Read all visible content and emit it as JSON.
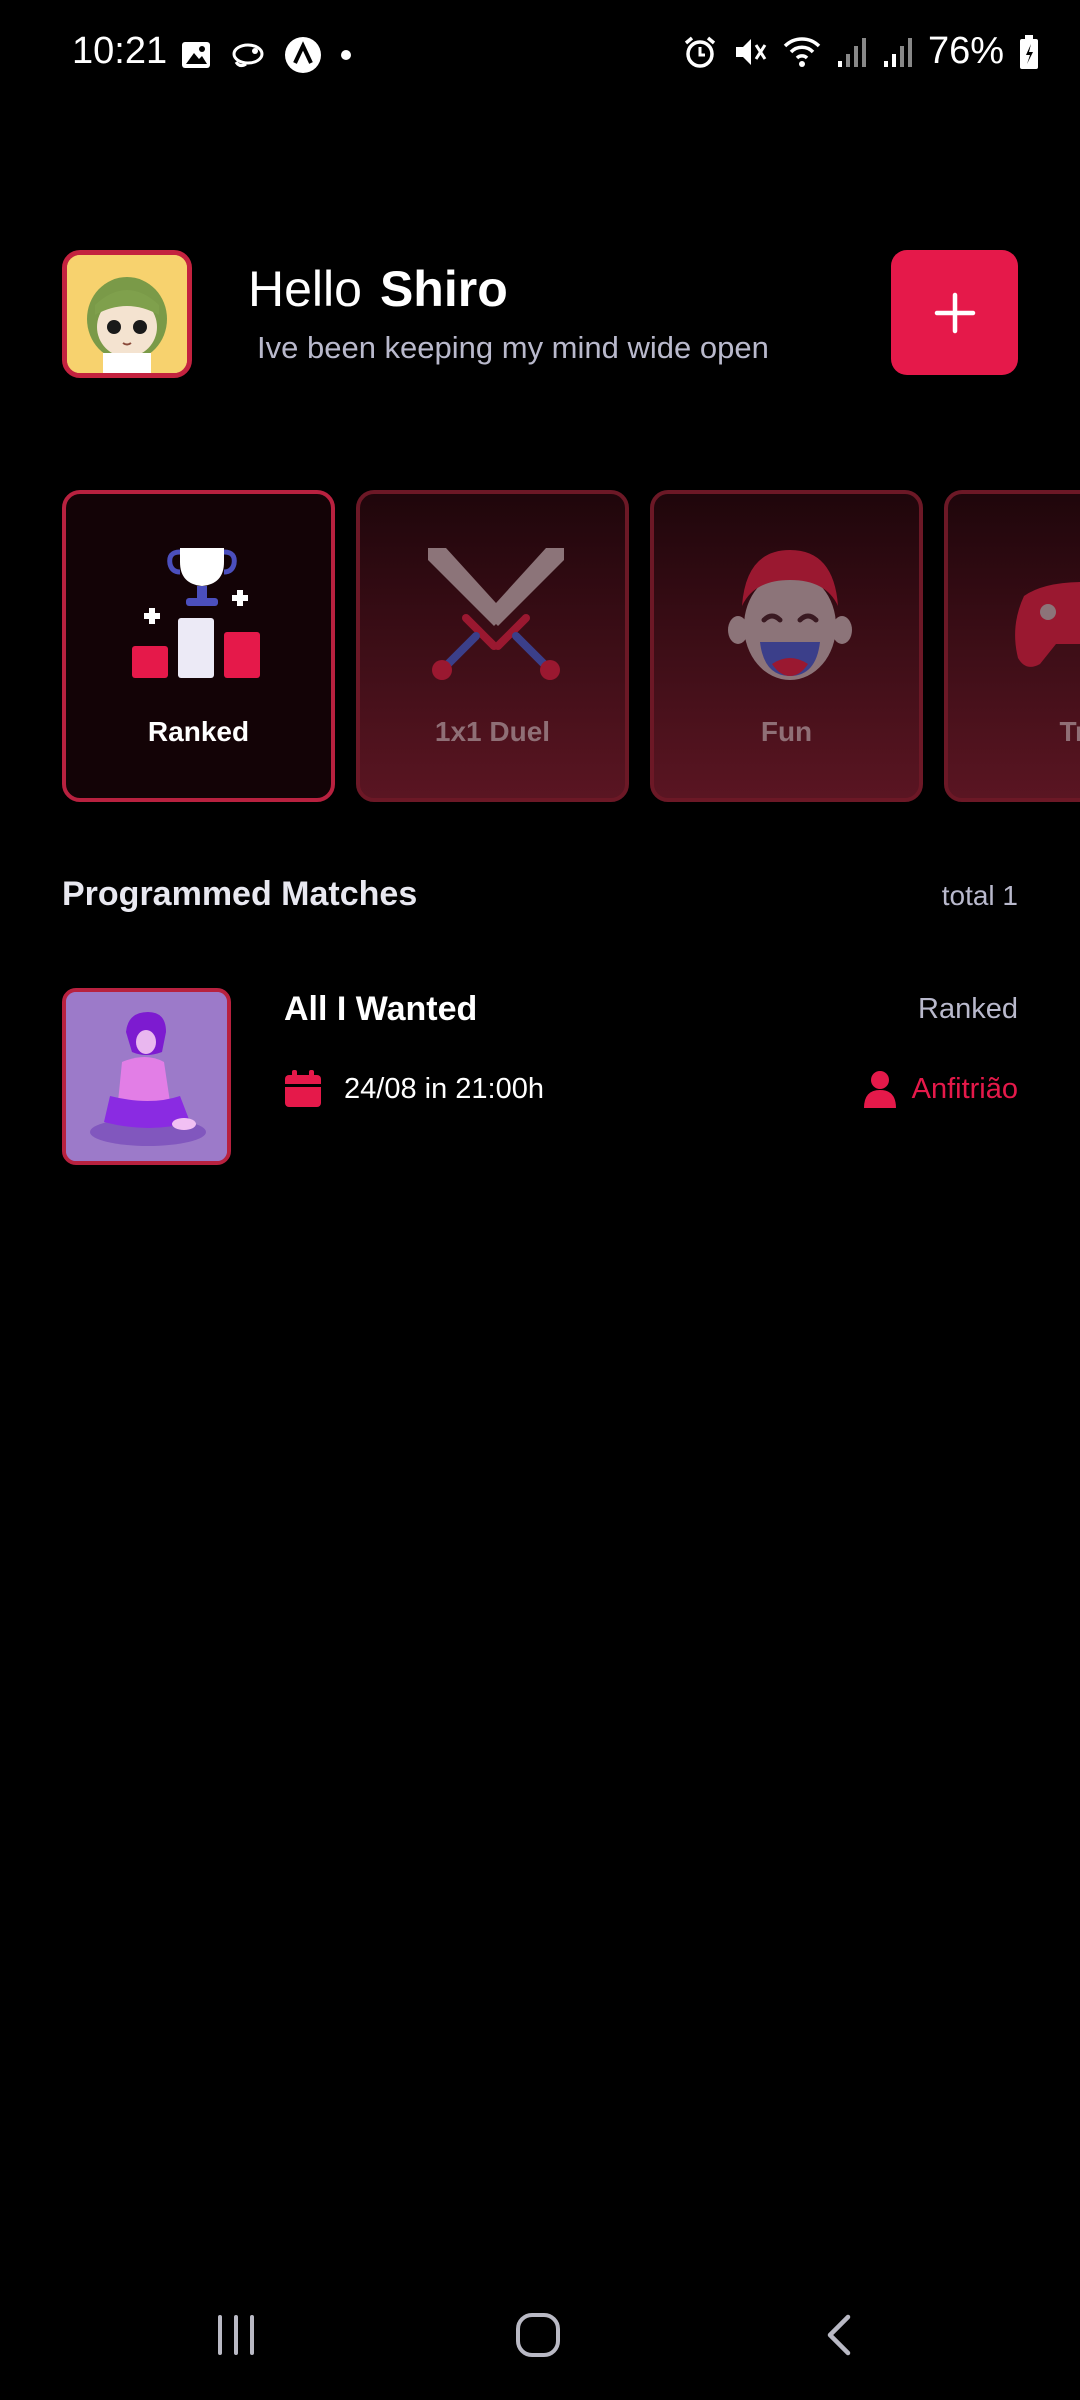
{
  "status_bar": {
    "time": "10:21",
    "battery_percent": "76%",
    "left_icons": [
      "gallery-icon",
      "chameleon-icon",
      "arrow-up-icon",
      "dot-icon"
    ],
    "right_icons": [
      "alarm-icon",
      "mute-icon",
      "wifi-icon",
      "signal-icon",
      "signal-icon",
      "battery-icon"
    ]
  },
  "header": {
    "greeting": "Hello",
    "user_name": "Shiro",
    "tagline": "Ive been keeping my mind wide open",
    "add_button_icon": "plus-icon"
  },
  "modes": [
    {
      "label": "Ranked",
      "icon": "podium-trophy-icon",
      "active": true
    },
    {
      "label": "1x1 Duel",
      "icon": "crossed-swords-icon",
      "active": false
    },
    {
      "label": "Fun",
      "icon": "laughing-face-icon",
      "active": false
    },
    {
      "label": "Tra",
      "icon": "gamepad-icon",
      "active": false
    }
  ],
  "programmed_matches": {
    "title": "Programmed Matches",
    "total": "total 1",
    "items": [
      {
        "title": "All I Wanted",
        "mode": "Ranked",
        "date": "24/08 in 21:00h",
        "host": "Anfitrião"
      }
    ]
  },
  "nav_bar": {
    "buttons": [
      "recent-apps-icon",
      "home-icon",
      "back-icon"
    ]
  },
  "colors": {
    "accent": "#e5194a",
    "background": "#000000",
    "muted_text": "#b9b9cc"
  }
}
